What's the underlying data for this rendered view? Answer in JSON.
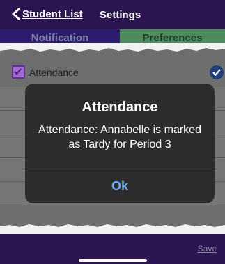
{
  "nav": {
    "back_label": "Student List",
    "title": "Settings"
  },
  "tabs": [
    {
      "label": "Notification",
      "selected": false
    },
    {
      "label": "Preferences",
      "selected": true
    }
  ],
  "content": {
    "row_label": "Attendance",
    "row_checked": true
  },
  "dialog": {
    "title": "Attendance",
    "message": "Attendance: Annabelle is marked as Tardy for Period 3",
    "button": "Ok"
  },
  "footer": {
    "save_label": "Save"
  },
  "icons": [
    "chevron-left-icon",
    "checkbox-icon",
    "checkmark-circle-icon"
  ],
  "colors": {
    "nav_bg": "#2b1450",
    "tab_selected": "#4e8a5e",
    "ok_blue": "#6aaef5"
  }
}
